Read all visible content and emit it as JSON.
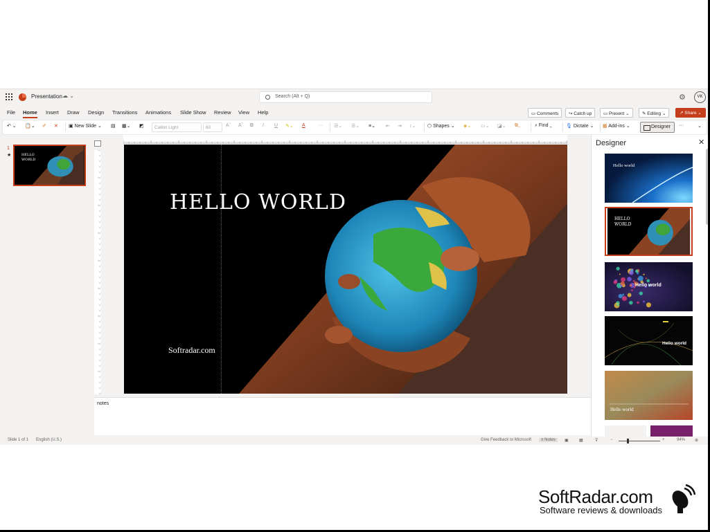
{
  "titlebar": {
    "doc_title": "Presentation",
    "doc_status": "☁ ⌄",
    "search_placeholder": "Search (Alt + Q)",
    "avatar": "VK"
  },
  "menu": {
    "tabs": [
      "File",
      "Home",
      "Insert",
      "Draw",
      "Design",
      "Transitions",
      "Animations",
      "Slide Show",
      "Review",
      "View",
      "Help"
    ],
    "active": "Home",
    "comments": "Comments",
    "catch_up": "Catch up",
    "present": "Present",
    "editing": "Editing",
    "share": "Share"
  },
  "ribbon": {
    "new_slide": "New Slide",
    "font_name": "Calibri Light",
    "font_size": "60",
    "grow_font": "Aˆ",
    "shrink_font": "Aˇ",
    "bold": "B",
    "italic": "I",
    "underline": "U",
    "font_color": "A",
    "more": "···",
    "shapes": "Shapes",
    "find": "Find",
    "dictate": "Dictate",
    "addins": "Add-ins",
    "designer": "Designer"
  },
  "thumbnails": {
    "slide_number": "1",
    "star": "★",
    "thumb_title": "HELLO\nWORLD"
  },
  "slide": {
    "title": "HELLO WORLD",
    "subtitle": "Softradar.com"
  },
  "notes": {
    "text": "notes"
  },
  "designer": {
    "title": "Designer",
    "close": "✕",
    "designs": [
      {
        "label": "Hello world"
      },
      {
        "label": "HELLO WORLD"
      },
      {
        "label": "Hello world"
      },
      {
        "label": "Hello world"
      },
      {
        "label": "Hello world"
      }
    ]
  },
  "statusbar": {
    "slide_info": "Slide 1 of 1",
    "language": "English (U.S.)",
    "feedback": "Give Feedback to Microsoft",
    "notes": "Notes",
    "zoom": "94%"
  },
  "watermark": {
    "brand": "SoftRadar.com",
    "tagline": "Software reviews & downloads"
  },
  "colors": {
    "accent": "#c43e1c",
    "background": "#f3f2f1"
  }
}
